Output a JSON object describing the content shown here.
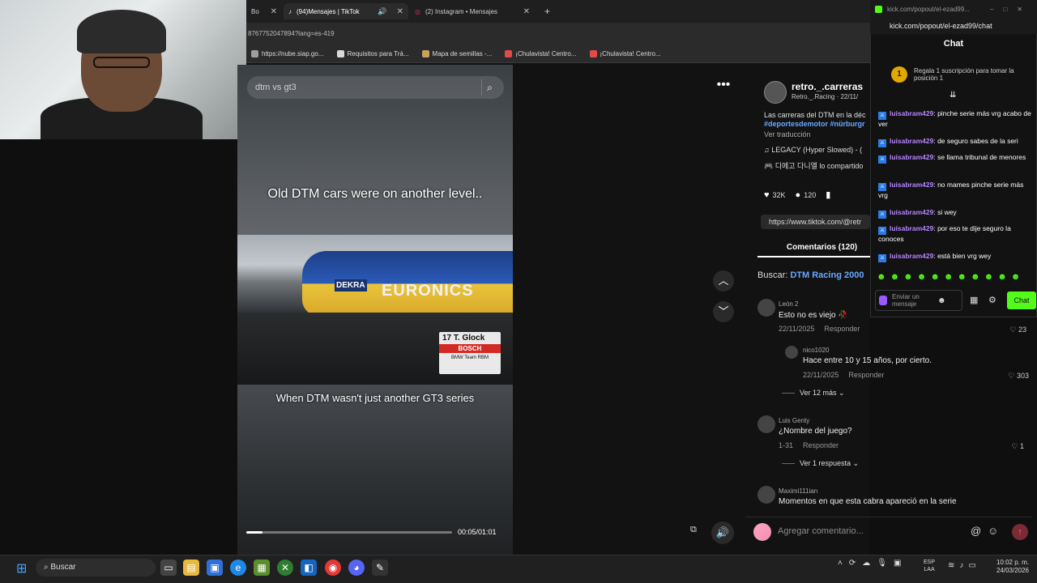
{
  "colors": {
    "accent_kick": "#53fc18",
    "tiktok_link": "#6aa8ff",
    "chat_user": "#b784ff",
    "send_button": "#7a2b36"
  },
  "browser": {
    "tabs": [
      {
        "label": "Bo",
        "icon": "app-icon"
      },
      {
        "label": "(94)Mensajes | TikTok",
        "icon": "tiktok-icon",
        "active": true
      },
      {
        "label": "(2) Instagram • Mensajes",
        "icon": "instagram-icon"
      }
    ],
    "new_tab": "+",
    "address": "8767752047894?lang=es-419",
    "bookmarks": [
      {
        "label": "https://nube.siap.go...",
        "color": "#9e9e9e"
      },
      {
        "label": "Requisitos para Trá...",
        "color": "#d9d9d9"
      },
      {
        "label": "Mapa de semillas -...",
        "color": "#c9a35b"
      },
      {
        "label": "¡Chulavista! Centro...",
        "color": "#e04b4b"
      },
      {
        "label": "¡Chulavista! Centro...",
        "color": "#e04b4b"
      }
    ]
  },
  "video": {
    "search_placeholder": "dtm vs gt3",
    "caption_top": "Old DTM cars were on another level..",
    "caption_bottom": "When DTM wasn't just another GT3 series",
    "time": "00:05/01:01",
    "progress": 0.08,
    "race": {
      "sponsor": "EURONICS",
      "badge": "DEKRA",
      "plate_number": "17",
      "plate_driver": "T. Glock",
      "plate_sponsor": "BOSCH",
      "plate_team": "BMW Team RBM"
    }
  },
  "post": {
    "author": "retro._.carreras",
    "author_sub": "Retro._.Racing · 22/11/",
    "description": "Las carreras del DTM en la déc",
    "hashtags": "#deportesdemotor #nürburgr",
    "translate": "Ver traducción",
    "music": "♫  LEGACY (Hyper Slowed) - (",
    "collab": "🎮 디에고 다니엘 lo compartido",
    "likes": "32K",
    "comments_count": "120",
    "link": "https://www.tiktok.com/@retr",
    "comments_tab": "Comentarios (120)",
    "search_label": "Buscar: ",
    "search_query": "DTM Racing 2000"
  },
  "comments": [
    {
      "user": "León 2",
      "text": "Esto no es viejo 🥀",
      "date": "22/11/2025",
      "reply": "Responder",
      "likes": "23"
    },
    {
      "user": "nico1020",
      "text": "Hace entre 10 y 15 años, por cierto.",
      "date": "22/11/2025",
      "reply": "Responder",
      "likes": "303",
      "more": "Ver 12 más ⌄"
    },
    {
      "user": "Luis Genty",
      "text": "¿Nombre del juego?",
      "date": "1-31",
      "reply": "Responder",
      "likes": "1",
      "more": "Ver 1 respuesta ⌄"
    },
    {
      "user": "Maximi111ian",
      "text": "Momentos en que esta cabra apareció en la serie"
    }
  ],
  "composer": {
    "placeholder": "Agregar comentario...",
    "at": "@",
    "emoji": "☺",
    "send": "↑"
  },
  "kick": {
    "window_title": "kick.com/popout/el-ezad99...",
    "url": "kick.com/popout/el-ezad99/chat",
    "heading": "Chat",
    "sub_badge": "1",
    "sub_text": "Regala 1 suscripción para tomar la posición 1",
    "pin": "⇊",
    "messages": [
      {
        "user": "luisabram429",
        "text": ": pinche serie más vrg acabo de ver"
      },
      {
        "user": "luisabram429",
        "text": ": de seguro sabes de la seri"
      },
      {
        "user": "luisabram429",
        "text": ": se llama tribunal de menores"
      },
      {
        "user": "luisabram429",
        "text": ": no mames pinche serie más vrg"
      },
      {
        "user": "luisabram429",
        "text": ": si wey"
      },
      {
        "user": "luisabram429",
        "text": ": por eso te dije seguro la conoces"
      },
      {
        "user": "luisabram429",
        "text": ": está bien vrg wey"
      }
    ],
    "emotes": [
      "☻",
      "☻",
      "☻",
      "☻",
      "☻",
      "☻",
      "☻",
      "☻",
      "☻",
      "☻",
      "☻"
    ],
    "input_placeholder": "Enviar un mensaje",
    "chat_button": "Chat"
  },
  "taskbar": {
    "search": "Buscar",
    "lang": "ESP\nLAA",
    "time": "10:02 p. m.",
    "date": "24/03/2026"
  }
}
